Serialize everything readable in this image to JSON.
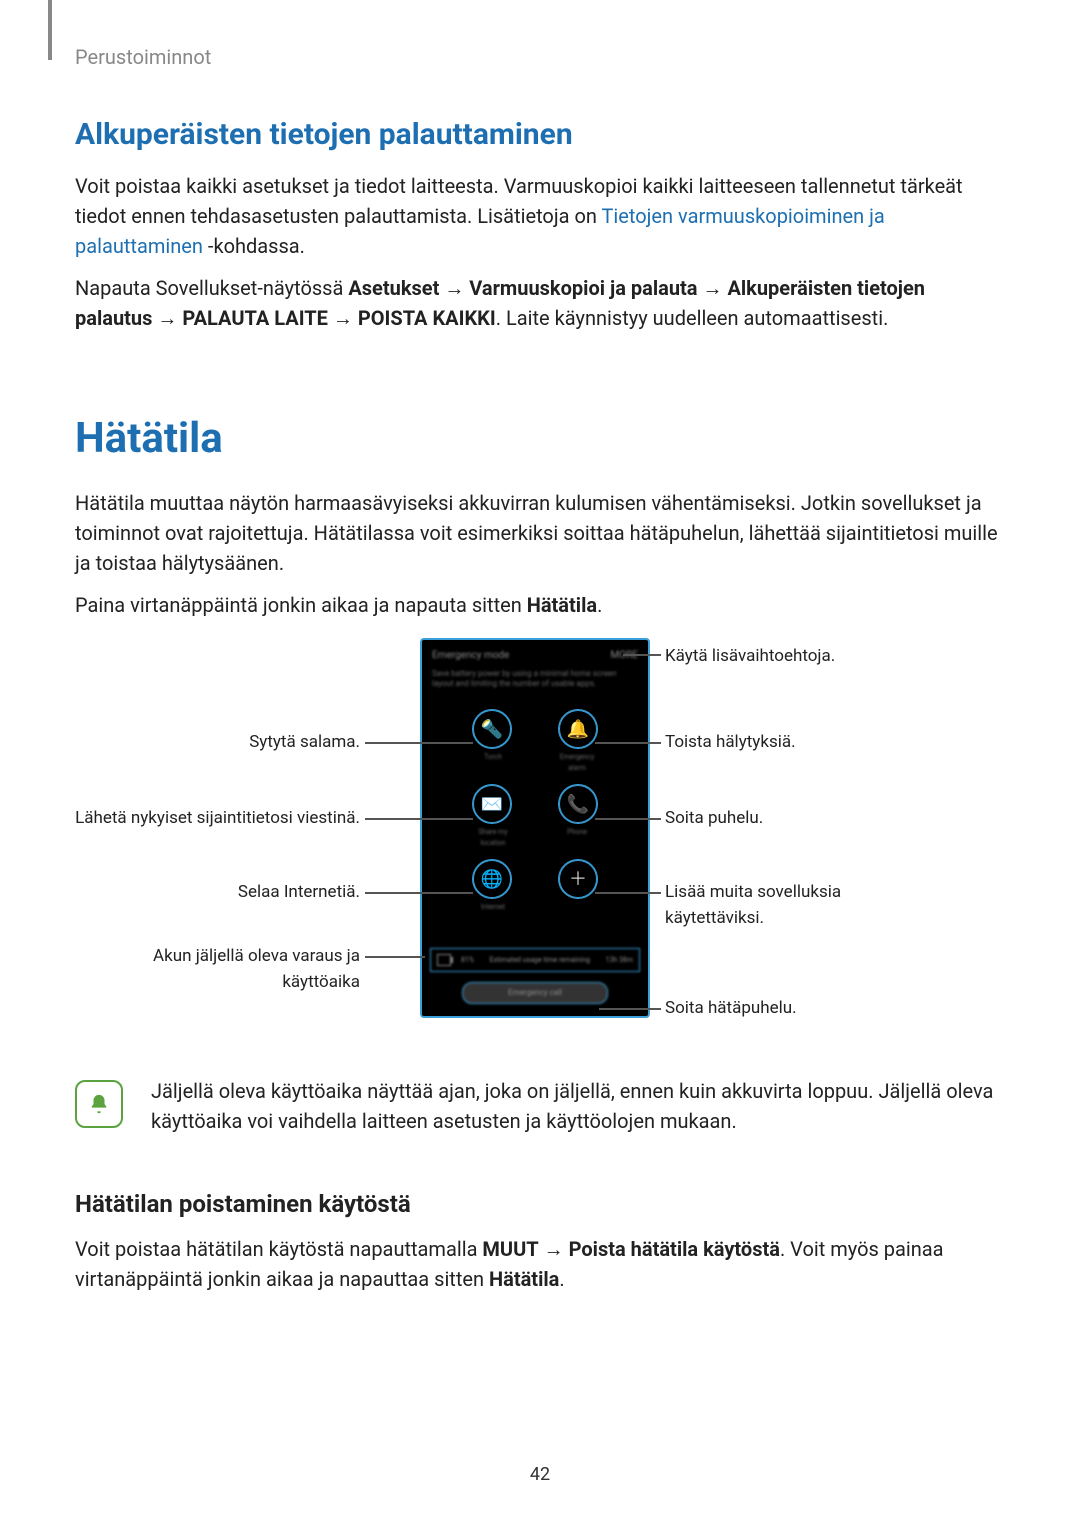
{
  "header": "Perustoiminnot",
  "section1": {
    "title": "Alkuperäisten tietojen palauttaminen",
    "p1a": "Voit poistaa kaikki asetukset ja tiedot laitteesta. Varmuuskopioi kaikki laitteeseen tallennetut tärkeät tiedot ennen tehdasasetusten palauttamista. Lisätietoja on ",
    "p1link": "Tietojen varmuuskopioiminen ja palauttaminen",
    "p1b": " -kohdassa.",
    "p2a": "Napauta Sovellukset-näytössä ",
    "p2bold": "Asetukset → Varmuuskopioi ja palauta → Alkuperäisten tietojen palautus → PALAUTA LAITE → POISTA KAIKKI",
    "p2b": ". Laite käynnistyy uudelleen automaattisesti."
  },
  "section2": {
    "title": "Hätätila",
    "p1": "Hätätila muuttaa näytön harmaasävyiseksi akkuvirran kulumisen vähentämiseksi. Jotkin sovellukset ja toiminnot ovat rajoitettuja. Hätätilassa voit esimerkiksi soittaa hätäpuhelun, lähettää sijaintitietosi muille ja toistaa hälytysäänen.",
    "p2a": "Paina virtanäppäintä jonkin aikaa ja napauta sitten ",
    "p2bold": "Hätätila",
    "p2b": "."
  },
  "callouts": {
    "more": "Käytä lisävaihtoehtoja.",
    "flash": "Sytytä salama.",
    "alarm": "Toista hälytyksiä.",
    "location": "Lähetä nykyiset sijaintitietosi viestinä.",
    "call": "Soita puhelu.",
    "internet": "Selaa Internetiä.",
    "add": "Lisää muita sovelluksia käytettäviksi.",
    "battery": "Akun jäljellä oleva varaus ja käyttöaika",
    "emergency": "Soita hätäpuhelu."
  },
  "phone": {
    "title": "Emergency mode",
    "more": "MORE",
    "desc": "Save battery power by using a minimal home screen layout and limiting the number of usable apps.",
    "row1a": "Torch",
    "row1b": "Emergency alarm",
    "row2a": "Share my location",
    "row2b": "Phone",
    "row3a": "Internet",
    "status_pct": "81%",
    "status_mid": "Estimated usage time remaining",
    "status_time": "13h 38m",
    "emergency_label": "Emergency call"
  },
  "note": "Jäljellä oleva käyttöaika näyttää ajan, joka on jäljellä, ennen kuin akkuvirta loppuu. Jäljellä oleva käyttöaika voi vaihdella laitteen asetusten ja käyttöolojen mukaan.",
  "section3": {
    "title": "Hätätilan poistaminen käytöstä",
    "p1a": "Voit poistaa hätätilan käytöstä napauttamalla ",
    "p1bold1": "MUUT",
    "p1mid": " → ",
    "p1bold2": "Poista hätätila käytöstä",
    "p1b": ". Voit myös painaa virtanäppäintä jonkin aikaa ja napauttaa sitten ",
    "p1bold3": "Hätätila",
    "p1c": "."
  },
  "page": "42"
}
